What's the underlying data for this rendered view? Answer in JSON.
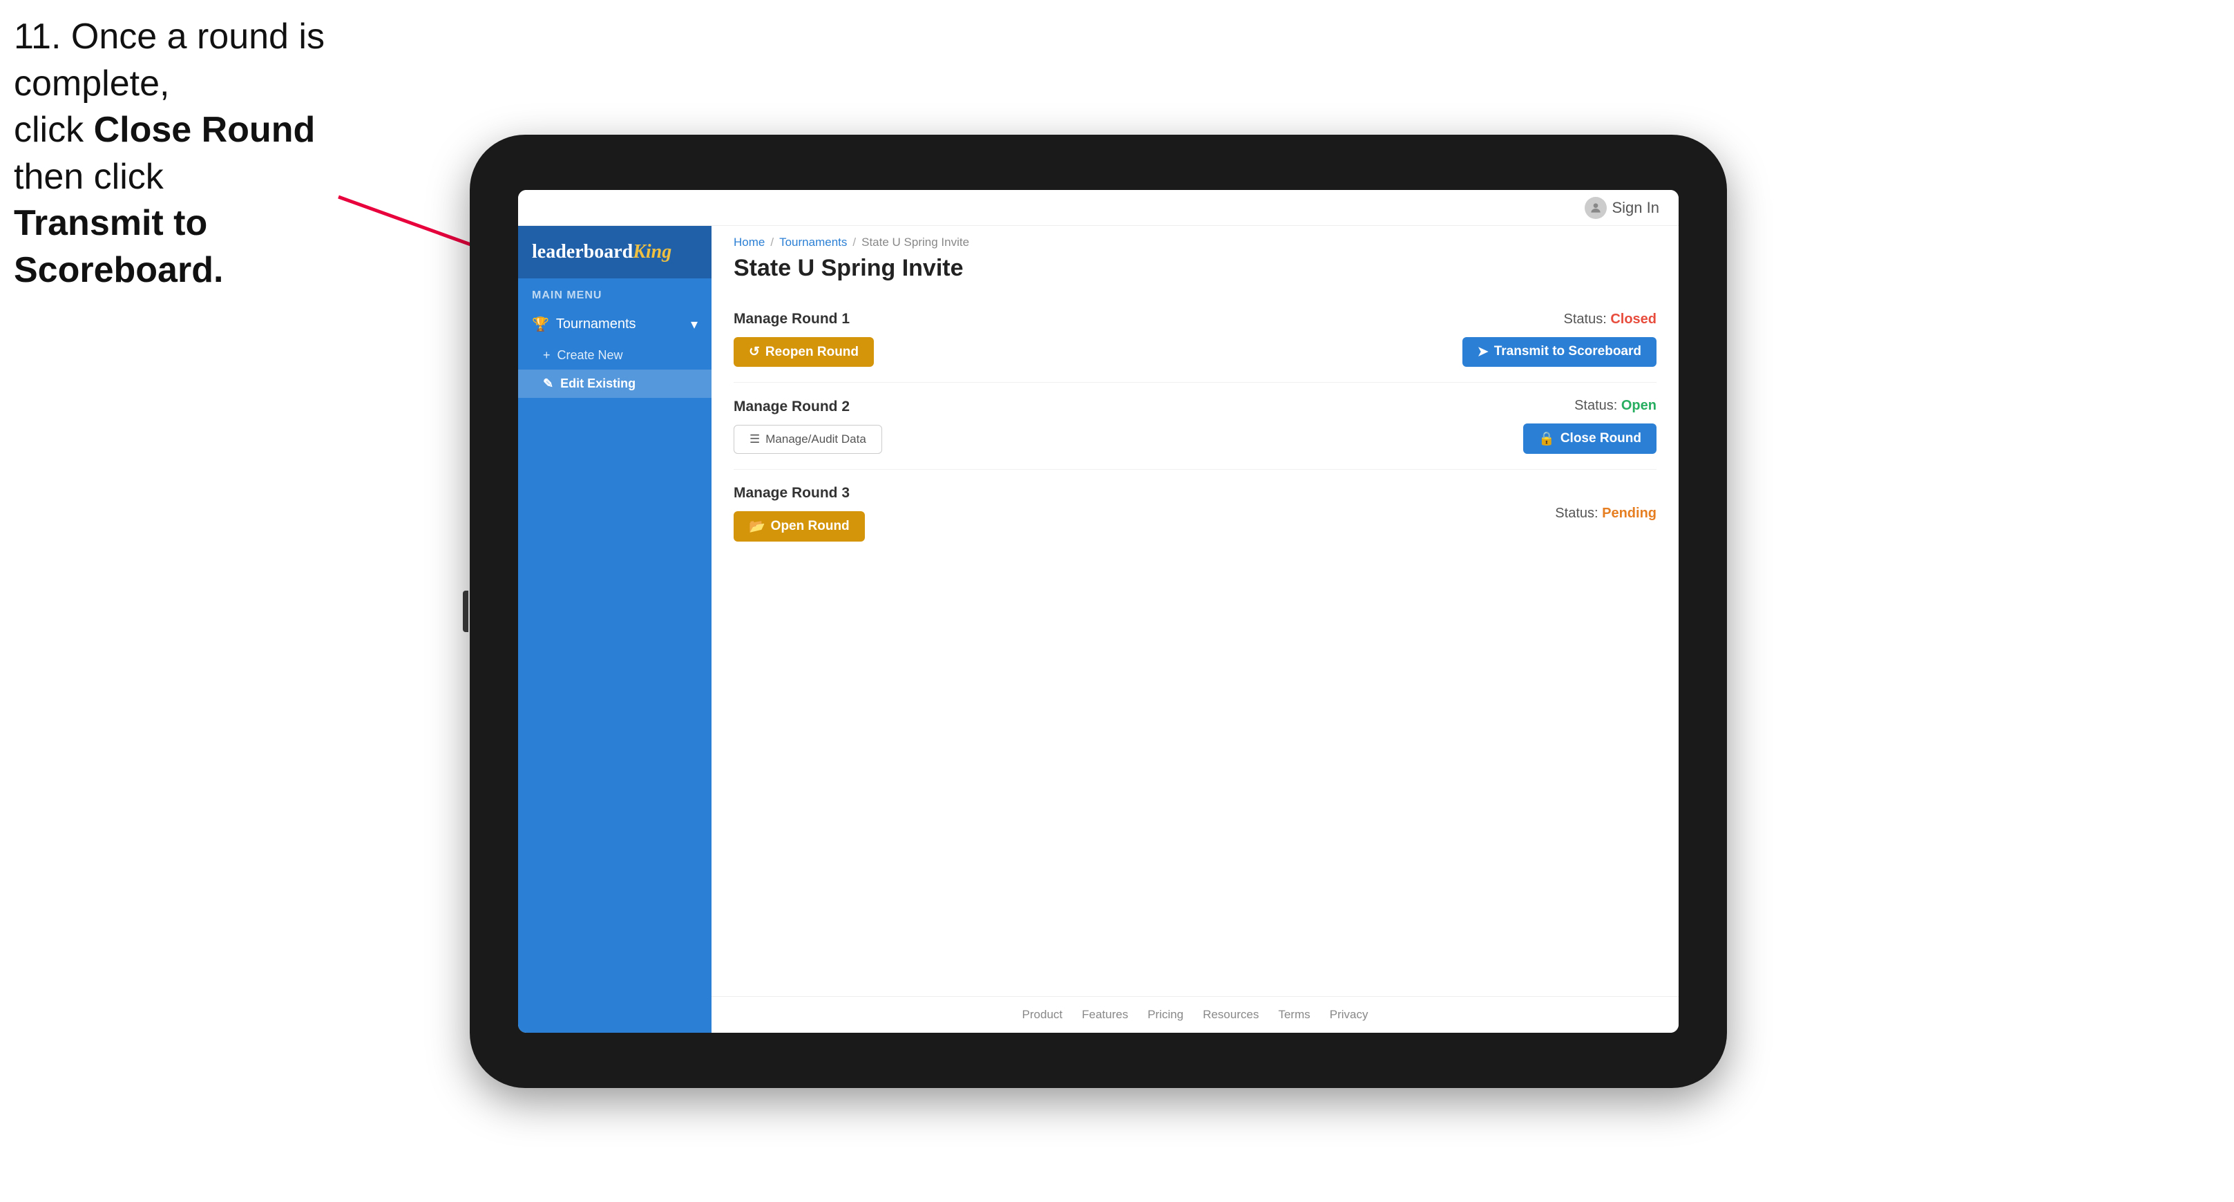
{
  "instruction": {
    "line1": "11. Once a round is complete,",
    "line2": "click ",
    "bold1": "Close Round",
    "line3": " then click",
    "bold2": "Transmit to Scoreboard."
  },
  "topbar": {
    "signin_label": "Sign In"
  },
  "sidebar": {
    "logo": {
      "prefix": "leaderboard",
      "suffix": "King"
    },
    "main_menu_label": "MAIN MENU",
    "tournaments_label": "Tournaments",
    "create_new_label": "Create New",
    "edit_existing_label": "Edit Existing"
  },
  "breadcrumb": {
    "home": "Home",
    "sep1": "/",
    "tournaments": "Tournaments",
    "sep2": "/",
    "current": "State U Spring Invite"
  },
  "page": {
    "title": "State U Spring Invite"
  },
  "rounds": [
    {
      "id": 1,
      "title": "Manage Round 1",
      "status_label": "Status:",
      "status_value": "Closed",
      "status_type": "closed",
      "primary_btn": "Reopen Round",
      "primary_btn_type": "gold",
      "secondary_btn": "Transmit to Scoreboard",
      "secondary_btn_type": "blue"
    },
    {
      "id": 2,
      "title": "Manage Round 2",
      "status_label": "Status:",
      "status_value": "Open",
      "status_type": "open",
      "primary_btn": "Manage/Audit Data",
      "primary_btn_type": "outline",
      "secondary_btn": "Close Round",
      "secondary_btn_type": "blue"
    },
    {
      "id": 3,
      "title": "Manage Round 3",
      "status_label": "Status:",
      "status_value": "Pending",
      "status_type": "pending",
      "primary_btn": "Open Round",
      "primary_btn_type": "gold",
      "secondary_btn": null
    }
  ],
  "footer": {
    "links": [
      "Product",
      "Features",
      "Pricing",
      "Resources",
      "Terms",
      "Privacy"
    ]
  }
}
